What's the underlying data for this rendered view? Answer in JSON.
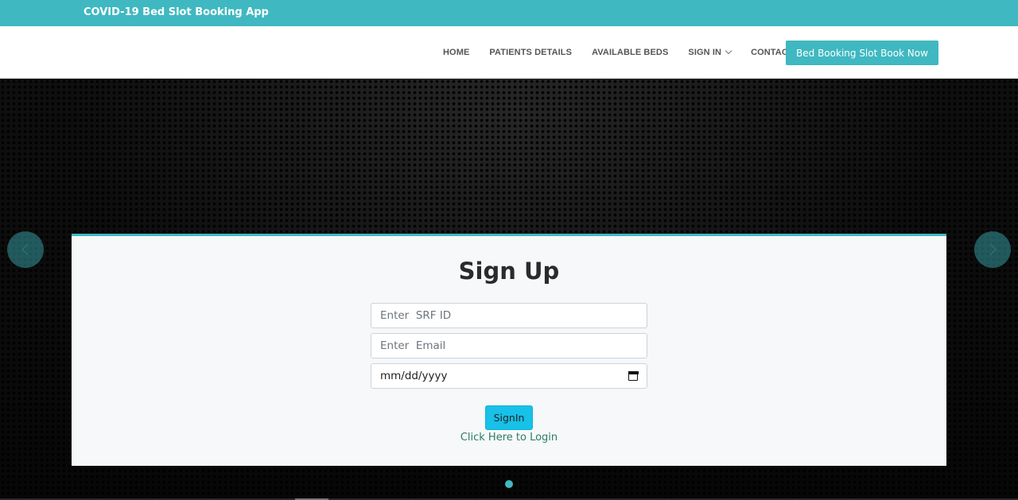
{
  "topbar": {
    "brand": "COVID-19 Bed Slot Booking App"
  },
  "nav": {
    "links": [
      {
        "label": "HOME"
      },
      {
        "label": "PATIENTS DETAILS"
      },
      {
        "label": "AVAILABLE BEDS"
      },
      {
        "label": "SIGN IN",
        "has_dropdown": true
      },
      {
        "label": "CONTACT"
      }
    ],
    "cta_label": "Bed Booking Slot Book Now"
  },
  "form": {
    "title": "Sign Up",
    "srf_placeholder": "Enter  SRF ID",
    "email_placeholder": "Enter  Email",
    "date_value": "mm/dd/yyyy",
    "submit_label": "SignIn",
    "login_link": "Click Here to Login"
  },
  "carousel": {
    "slide_count": 1,
    "active_slide": 1
  },
  "colors": {
    "accent": "#3fb8c1",
    "button": "#17c1e8",
    "link": "#2e7d60"
  }
}
